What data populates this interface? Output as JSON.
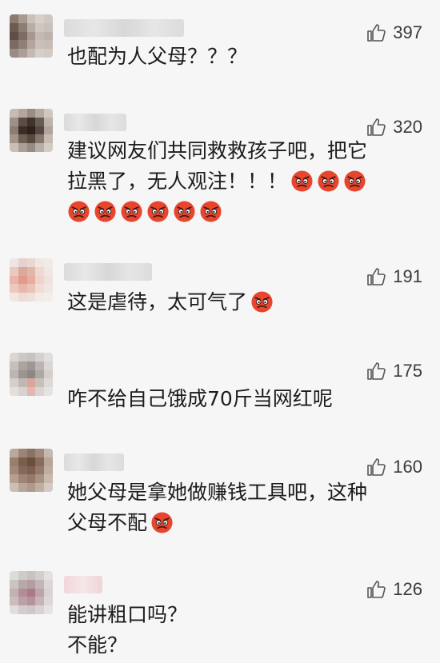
{
  "comments": [
    {
      "likes": "397",
      "text": "也配为人父母？？？",
      "emojis_inline": 0,
      "emoji_rows": []
    },
    {
      "likes": "320",
      "text": "建议网友们共同救救孩子吧，把它\n拉黑了，无人观注！！！",
      "emojis_after_text": 3,
      "emoji_rows": [
        6
      ]
    },
    {
      "likes": "191",
      "text": "这是虐待，太可气了",
      "emojis_after_text": 1,
      "emoji_rows": []
    },
    {
      "likes": "175",
      "text": "咋不给自己饿成70斤当网红呢",
      "emojis_after_text": 0,
      "emoji_rows": []
    },
    {
      "likes": "160",
      "text": "她父母是拿她做赚钱工具吧，这种\n父母不配",
      "emojis_after_text": 1,
      "emoji_rows": []
    },
    {
      "likes": "126",
      "text": "能讲粗口吗？\n不能？",
      "emojis_after_text": 0,
      "emoji_rows": []
    }
  ],
  "icons": {
    "like": "thumbs-up-icon",
    "emoji": "angry-face-emoji-icon"
  },
  "colors": {
    "background": "#f6f6f6",
    "text": "#1c1c1c",
    "emoji_face": "#e8452f"
  }
}
